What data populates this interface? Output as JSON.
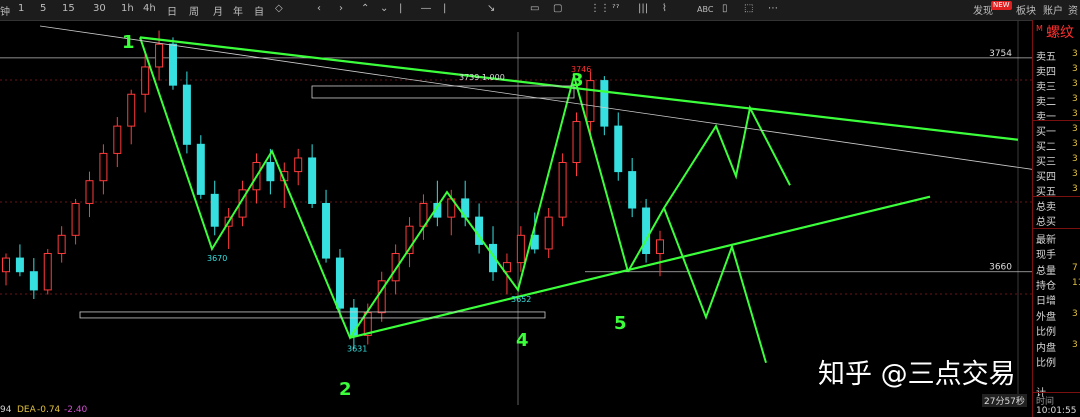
{
  "toolbar": {
    "items": [
      "钟",
      "1",
      "5",
      "15",
      "30",
      "1h",
      "4h",
      "日",
      "周",
      "月",
      "年",
      "自",
      "◇",
      "‹",
      "›",
      "⌃",
      "⌄",
      "|",
      "―",
      "|",
      "↘",
      "▭",
      "▢",
      "⋮⋮",
      "ˀˀ",
      "|||",
      "⌇",
      "ABC",
      "▯",
      "⬚",
      "⋯"
    ],
    "right": [
      "发现",
      "板块",
      "账户",
      "资"
    ],
    "badge": "NEW"
  },
  "chart_data": {
    "type": "candlestick",
    "y_range": [
      3619,
      3768
    ],
    "price_lines": [
      3754,
      3660
    ],
    "price_labels": [
      "3754",
      "3660"
    ],
    "pivot_labels": [
      {
        "text": "3670",
        "price": 3670
      },
      {
        "text": "3631",
        "price": 3631
      },
      {
        "text": "3652",
        "price": 3652
      },
      {
        "text": "3746",
        "price": 3746
      },
      {
        "text": "3739 1.000",
        "price": 3739
      }
    ],
    "wave_labels": [
      "1",
      "2",
      "3",
      "4",
      "5"
    ],
    "zigzag_prices": [
      3763,
      3670,
      3713,
      3631,
      3695,
      3652,
      3746,
      3660
    ],
    "candles": [
      [
        3660,
        3668,
        3654,
        3666
      ],
      [
        3666,
        3672,
        3658,
        3660
      ],
      [
        3660,
        3666,
        3648,
        3652
      ],
      [
        3652,
        3670,
        3650,
        3668
      ],
      [
        3668,
        3680,
        3664,
        3676
      ],
      [
        3676,
        3692,
        3672,
        3690
      ],
      [
        3690,
        3704,
        3684,
        3700
      ],
      [
        3700,
        3716,
        3694,
        3712
      ],
      [
        3712,
        3728,
        3706,
        3724
      ],
      [
        3724,
        3740,
        3716,
        3738
      ],
      [
        3738,
        3756,
        3730,
        3750
      ],
      [
        3750,
        3766,
        3744,
        3760
      ],
      [
        3760,
        3763,
        3740,
        3742
      ],
      [
        3742,
        3748,
        3712,
        3716
      ],
      [
        3716,
        3720,
        3692,
        3694
      ],
      [
        3694,
        3700,
        3676,
        3680
      ],
      [
        3680,
        3688,
        3670,
        3684
      ],
      [
        3684,
        3700,
        3680,
        3696
      ],
      [
        3696,
        3712,
        3690,
        3708
      ],
      [
        3708,
        3714,
        3694,
        3700
      ],
      [
        3700,
        3708,
        3688,
        3704
      ],
      [
        3704,
        3714,
        3698,
        3710
      ],
      [
        3710,
        3716,
        3688,
        3690
      ],
      [
        3690,
        3696,
        3664,
        3666
      ],
      [
        3666,
        3670,
        3640,
        3644
      ],
      [
        3644,
        3648,
        3626,
        3632
      ],
      [
        3632,
        3646,
        3628,
        3642
      ],
      [
        3642,
        3660,
        3638,
        3656
      ],
      [
        3656,
        3672,
        3650,
        3668
      ],
      [
        3668,
        3684,
        3662,
        3680
      ],
      [
        3680,
        3694,
        3674,
        3690
      ],
      [
        3690,
        3700,
        3680,
        3684
      ],
      [
        3684,
        3696,
        3676,
        3692
      ],
      [
        3692,
        3700,
        3680,
        3684
      ],
      [
        3684,
        3690,
        3668,
        3672
      ],
      [
        3672,
        3680,
        3656,
        3660
      ],
      [
        3660,
        3668,
        3650,
        3664
      ],
      [
        3664,
        3680,
        3660,
        3676
      ],
      [
        3676,
        3686,
        3668,
        3670
      ],
      [
        3670,
        3688,
        3666,
        3684
      ],
      [
        3684,
        3712,
        3680,
        3708
      ],
      [
        3708,
        3730,
        3702,
        3726
      ],
      [
        3726,
        3748,
        3718,
        3744
      ],
      [
        3744,
        3746,
        3720,
        3724
      ],
      [
        3724,
        3730,
        3700,
        3704
      ],
      [
        3704,
        3710,
        3684,
        3688
      ],
      [
        3688,
        3692,
        3664,
        3668
      ],
      [
        3668,
        3678,
        3658,
        3674
      ]
    ]
  },
  "bottom": {
    "left_a": "94",
    "dea_label": "DEA",
    "dea_value": "-0.74",
    "value2": "-2.40",
    "timer": "27分57秒"
  },
  "side_panel": {
    "title": "螺纹",
    "mark": "M",
    "rows": [
      {
        "label": "卖五",
        "value": "3"
      },
      {
        "label": "卖四",
        "value": "3"
      },
      {
        "label": "卖三",
        "value": "3"
      },
      {
        "label": "卖二",
        "value": "3"
      },
      {
        "label": "卖一",
        "value": "3"
      },
      {
        "label": "买一",
        "value": "3"
      },
      {
        "label": "买二",
        "value": "3"
      },
      {
        "label": "买三",
        "value": "3"
      },
      {
        "label": "买四",
        "value": "3"
      },
      {
        "label": "买五",
        "value": "3"
      },
      {
        "label": "总卖",
        "value": ""
      },
      {
        "label": "总买",
        "value": ""
      },
      {
        "label": "最新",
        "value": ""
      },
      {
        "label": "现手",
        "value": ""
      },
      {
        "label": "总量",
        "value": "7"
      },
      {
        "label": "持仓",
        "value": "11"
      },
      {
        "label": "日增",
        "value": ""
      },
      {
        "label": "外盘",
        "value": "3"
      },
      {
        "label": "比例",
        "value": ""
      },
      {
        "label": "内盘",
        "value": "3"
      },
      {
        "label": "比例",
        "value": ""
      },
      {
        "label": "计",
        "value": ""
      }
    ],
    "time_label": "时间",
    "time_value": "10:01:55"
  },
  "watermark": "知乎 @三点交易"
}
